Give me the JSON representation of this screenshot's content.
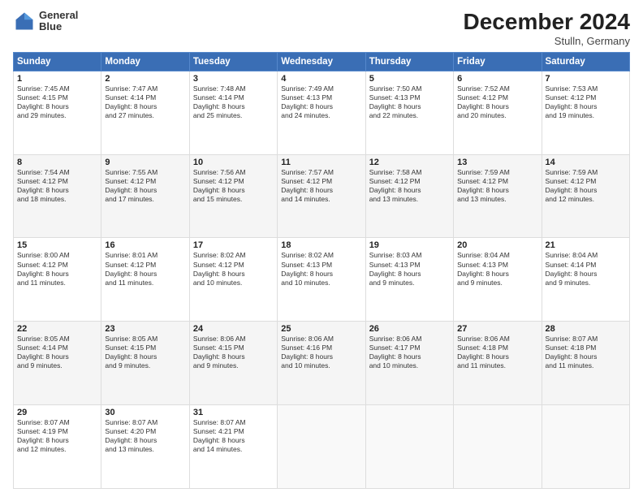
{
  "header": {
    "logo_line1": "General",
    "logo_line2": "Blue",
    "month": "December 2024",
    "location": "Stulln, Germany"
  },
  "weekdays": [
    "Sunday",
    "Monday",
    "Tuesday",
    "Wednesday",
    "Thursday",
    "Friday",
    "Saturday"
  ],
  "weeks": [
    [
      {
        "day": "1",
        "info": "Sunrise: 7:45 AM\nSunset: 4:15 PM\nDaylight: 8 hours\nand 29 minutes."
      },
      {
        "day": "2",
        "info": "Sunrise: 7:47 AM\nSunset: 4:14 PM\nDaylight: 8 hours\nand 27 minutes."
      },
      {
        "day": "3",
        "info": "Sunrise: 7:48 AM\nSunset: 4:14 PM\nDaylight: 8 hours\nand 25 minutes."
      },
      {
        "day": "4",
        "info": "Sunrise: 7:49 AM\nSunset: 4:13 PM\nDaylight: 8 hours\nand 24 minutes."
      },
      {
        "day": "5",
        "info": "Sunrise: 7:50 AM\nSunset: 4:13 PM\nDaylight: 8 hours\nand 22 minutes."
      },
      {
        "day": "6",
        "info": "Sunrise: 7:52 AM\nSunset: 4:12 PM\nDaylight: 8 hours\nand 20 minutes."
      },
      {
        "day": "7",
        "info": "Sunrise: 7:53 AM\nSunset: 4:12 PM\nDaylight: 8 hours\nand 19 minutes."
      }
    ],
    [
      {
        "day": "8",
        "info": "Sunrise: 7:54 AM\nSunset: 4:12 PM\nDaylight: 8 hours\nand 18 minutes."
      },
      {
        "day": "9",
        "info": "Sunrise: 7:55 AM\nSunset: 4:12 PM\nDaylight: 8 hours\nand 17 minutes."
      },
      {
        "day": "10",
        "info": "Sunrise: 7:56 AM\nSunset: 4:12 PM\nDaylight: 8 hours\nand 15 minutes."
      },
      {
        "day": "11",
        "info": "Sunrise: 7:57 AM\nSunset: 4:12 PM\nDaylight: 8 hours\nand 14 minutes."
      },
      {
        "day": "12",
        "info": "Sunrise: 7:58 AM\nSunset: 4:12 PM\nDaylight: 8 hours\nand 13 minutes."
      },
      {
        "day": "13",
        "info": "Sunrise: 7:59 AM\nSunset: 4:12 PM\nDaylight: 8 hours\nand 13 minutes."
      },
      {
        "day": "14",
        "info": "Sunrise: 7:59 AM\nSunset: 4:12 PM\nDaylight: 8 hours\nand 12 minutes."
      }
    ],
    [
      {
        "day": "15",
        "info": "Sunrise: 8:00 AM\nSunset: 4:12 PM\nDaylight: 8 hours\nand 11 minutes."
      },
      {
        "day": "16",
        "info": "Sunrise: 8:01 AM\nSunset: 4:12 PM\nDaylight: 8 hours\nand 11 minutes."
      },
      {
        "day": "17",
        "info": "Sunrise: 8:02 AM\nSunset: 4:12 PM\nDaylight: 8 hours\nand 10 minutes."
      },
      {
        "day": "18",
        "info": "Sunrise: 8:02 AM\nSunset: 4:13 PM\nDaylight: 8 hours\nand 10 minutes."
      },
      {
        "day": "19",
        "info": "Sunrise: 8:03 AM\nSunset: 4:13 PM\nDaylight: 8 hours\nand 9 minutes."
      },
      {
        "day": "20",
        "info": "Sunrise: 8:04 AM\nSunset: 4:13 PM\nDaylight: 8 hours\nand 9 minutes."
      },
      {
        "day": "21",
        "info": "Sunrise: 8:04 AM\nSunset: 4:14 PM\nDaylight: 8 hours\nand 9 minutes."
      }
    ],
    [
      {
        "day": "22",
        "info": "Sunrise: 8:05 AM\nSunset: 4:14 PM\nDaylight: 8 hours\nand 9 minutes."
      },
      {
        "day": "23",
        "info": "Sunrise: 8:05 AM\nSunset: 4:15 PM\nDaylight: 8 hours\nand 9 minutes."
      },
      {
        "day": "24",
        "info": "Sunrise: 8:06 AM\nSunset: 4:15 PM\nDaylight: 8 hours\nand 9 minutes."
      },
      {
        "day": "25",
        "info": "Sunrise: 8:06 AM\nSunset: 4:16 PM\nDaylight: 8 hours\nand 10 minutes."
      },
      {
        "day": "26",
        "info": "Sunrise: 8:06 AM\nSunset: 4:17 PM\nDaylight: 8 hours\nand 10 minutes."
      },
      {
        "day": "27",
        "info": "Sunrise: 8:06 AM\nSunset: 4:18 PM\nDaylight: 8 hours\nand 11 minutes."
      },
      {
        "day": "28",
        "info": "Sunrise: 8:07 AM\nSunset: 4:18 PM\nDaylight: 8 hours\nand 11 minutes."
      }
    ],
    [
      {
        "day": "29",
        "info": "Sunrise: 8:07 AM\nSunset: 4:19 PM\nDaylight: 8 hours\nand 12 minutes."
      },
      {
        "day": "30",
        "info": "Sunrise: 8:07 AM\nSunset: 4:20 PM\nDaylight: 8 hours\nand 13 minutes."
      },
      {
        "day": "31",
        "info": "Sunrise: 8:07 AM\nSunset: 4:21 PM\nDaylight: 8 hours\nand 14 minutes."
      },
      {
        "day": "",
        "info": ""
      },
      {
        "day": "",
        "info": ""
      },
      {
        "day": "",
        "info": ""
      },
      {
        "day": "",
        "info": ""
      }
    ]
  ]
}
